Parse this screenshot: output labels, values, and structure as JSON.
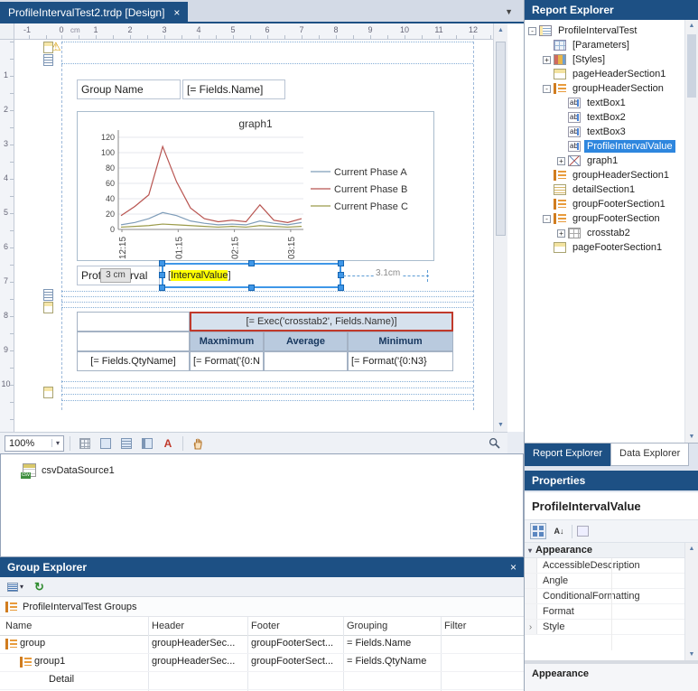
{
  "icons": {
    "close": "×",
    "overflow": "▼",
    "dropdown": "▾",
    "up": "▲",
    "down": "▼",
    "chevron": "›",
    "category_collapse": "▾",
    "warning": "⚠",
    "refresh": "↻",
    "font_a": "A",
    "sort_az": "A↓"
  },
  "doc_tab": {
    "title": "ProfileIntervalTest2.trdp [Design]"
  },
  "rulers": {
    "unit": "cm",
    "h_labels": [
      "-1",
      "0",
      "1",
      "2",
      "3",
      "4",
      "5",
      "6",
      "7",
      "8",
      "9",
      "10",
      "11",
      "12"
    ],
    "v_labels": [
      "1",
      "2",
      "3",
      "4",
      "5",
      "6",
      "7",
      "8",
      "9",
      "10"
    ]
  },
  "designer": {
    "textbox1": "Group Name",
    "textbox2": "[= Fields.Name]",
    "profile_label": "ProfileInterval",
    "size_badge": "3 cm",
    "selected_prefix": "[",
    "selected_highlight": "IntervalValue",
    "selected_suffix": "]",
    "width_label": "3.1cm",
    "zoom": "100%",
    "crosstab": {
      "header": "[= Exec('crosstab2', Fields.Name)]",
      "columns": [
        "Maxmimum",
        "Average",
        "Minimum"
      ],
      "row_label": "[= Fields.QtyName]",
      "cells": [
        "[= Format('{0:N",
        "",
        "[= Format('{0:N3}"
      ]
    }
  },
  "chart_data": {
    "type": "line",
    "title": "graph1",
    "x_labels": [
      "12:15",
      "01:15",
      "02:15",
      "03:15"
    ],
    "ylim": [
      0,
      120
    ],
    "yticks": [
      0,
      20,
      40,
      60,
      80,
      100,
      120
    ],
    "legend_position": "right",
    "grid": true,
    "series": [
      {
        "name": "Current Phase A",
        "color": "#7f9db9",
        "values": [
          6,
          9,
          14,
          22,
          18,
          11,
          8,
          6,
          7,
          6,
          11,
          8,
          6,
          9
        ]
      },
      {
        "name": "Current Phase B",
        "color": "#b85450",
        "values": [
          18,
          30,
          45,
          108,
          62,
          28,
          14,
          10,
          12,
          10,
          32,
          12,
          9,
          14
        ]
      },
      {
        "name": "Current Phase C",
        "color": "#9b9b4a",
        "values": [
          3,
          4,
          5,
          7,
          6,
          5,
          4,
          3,
          4,
          3,
          5,
          4,
          3,
          4
        ]
      }
    ]
  },
  "datasources": [
    {
      "name": "csvDataSource1"
    }
  ],
  "group_explorer": {
    "title": "Group Explorer",
    "groups_label": "ProfileIntervalTest Groups",
    "columns": [
      "Name",
      "Header",
      "Footer",
      "Grouping",
      "Filter"
    ],
    "rows": [
      {
        "name": "group",
        "indent": 0,
        "icon": true,
        "header": "groupHeaderSec...",
        "footer": "groupFooterSect...",
        "grouping": "= Fields.Name",
        "filter": ""
      },
      {
        "name": "group1",
        "indent": 1,
        "icon": true,
        "header": "groupHeaderSec...",
        "footer": "groupFooterSect...",
        "grouping": "= Fields.QtyName",
        "filter": ""
      },
      {
        "name": "Detail",
        "indent": 2,
        "icon": false,
        "header": "",
        "footer": "",
        "grouping": "",
        "filter": ""
      }
    ]
  },
  "report_explorer": {
    "title": "Report Explorer",
    "tree": [
      {
        "label": "ProfileIntervalTest",
        "level": 0,
        "expander": "-",
        "icon": "report"
      },
      {
        "label": "[Parameters]",
        "level": 1,
        "expander": "",
        "icon": "params"
      },
      {
        "label": "[Styles]",
        "level": 1,
        "expander": "+",
        "icon": "styles"
      },
      {
        "label": "pageHeaderSection1",
        "level": 1,
        "expander": "",
        "icon": "section"
      },
      {
        "label": "groupHeaderSection",
        "level": 1,
        "expander": "-",
        "icon": "group"
      },
      {
        "label": "textBox1",
        "level": 2,
        "expander": "",
        "icon": "ab"
      },
      {
        "label": "textBox2",
        "level": 2,
        "expander": "",
        "icon": "ab"
      },
      {
        "label": "textBox3",
        "level": 2,
        "expander": "",
        "icon": "ab"
      },
      {
        "label": "ProfileIntervalValue",
        "level": 2,
        "expander": "",
        "icon": "ab",
        "selected": true
      },
      {
        "label": "graph1",
        "level": 2,
        "expander": "+",
        "icon": "chart"
      },
      {
        "label": "groupHeaderSection1",
        "level": 1,
        "expander": "",
        "icon": "group"
      },
      {
        "label": "detailSection1",
        "level": 1,
        "expander": "",
        "icon": "detail"
      },
      {
        "label": "groupFooterSection1",
        "level": 1,
        "expander": "",
        "icon": "group"
      },
      {
        "label": "groupFooterSection",
        "level": 1,
        "expander": "-",
        "icon": "group"
      },
      {
        "label": "crosstab2",
        "level": 2,
        "expander": "+",
        "icon": "crosstab"
      },
      {
        "label": "pageFooterSection1",
        "level": 1,
        "expander": "",
        "icon": "section"
      }
    ],
    "tabs": [
      {
        "label": "Report Explorer",
        "active": true
      },
      {
        "label": "Data Explorer",
        "active": false
      }
    ]
  },
  "properties": {
    "title": "Properties",
    "object_name": "ProfileIntervalValue",
    "category": "Appearance",
    "rows": [
      {
        "name": "AccessibleDescription",
        "expandable": false
      },
      {
        "name": "Angle",
        "expandable": false
      },
      {
        "name": "ConditionalFormatting",
        "expandable": false
      },
      {
        "name": "Format",
        "expandable": false
      },
      {
        "name": "Style",
        "expandable": true
      }
    ],
    "description_title": "Appearance"
  }
}
